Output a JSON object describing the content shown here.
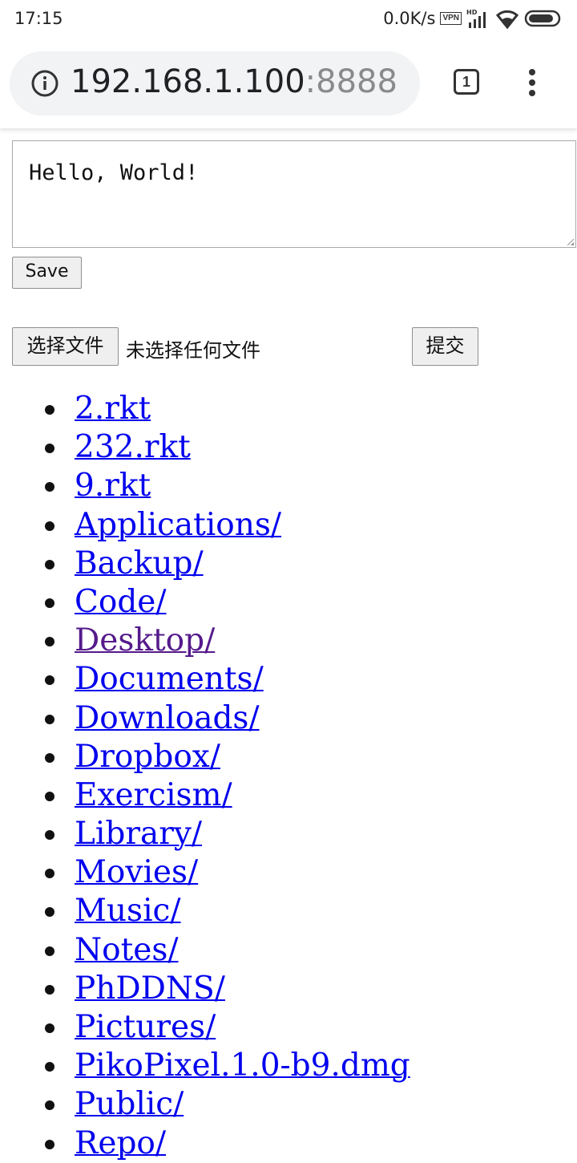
{
  "status_bar": {
    "time": "17:15",
    "net_speed": "0.0K/s",
    "vpn_label": "VPN",
    "hd_label": "HD"
  },
  "browser": {
    "url_host": "192.168.1.100",
    "url_port": ":8888",
    "tab_count": "1"
  },
  "editor": {
    "text": "Hello, World!",
    "save_label": "Save"
  },
  "upload": {
    "choose_label": "选择文件",
    "no_file_text": "未选择任何文件",
    "submit_label": "提交"
  },
  "files": [
    {
      "name": "2.rkt",
      "visited": false
    },
    {
      "name": "232.rkt",
      "visited": false
    },
    {
      "name": "9.rkt",
      "visited": false
    },
    {
      "name": "Applications/",
      "visited": false
    },
    {
      "name": "Backup/",
      "visited": false
    },
    {
      "name": "Code/",
      "visited": false
    },
    {
      "name": "Desktop/",
      "visited": true
    },
    {
      "name": "Documents/",
      "visited": false
    },
    {
      "name": "Downloads/",
      "visited": false
    },
    {
      "name": "Dropbox/",
      "visited": false
    },
    {
      "name": "Exercism/",
      "visited": false
    },
    {
      "name": "Library/",
      "visited": false
    },
    {
      "name": "Movies/",
      "visited": false
    },
    {
      "name": "Music/",
      "visited": false
    },
    {
      "name": "Notes/",
      "visited": false
    },
    {
      "name": "PhDDNS/",
      "visited": false
    },
    {
      "name": "Pictures/",
      "visited": false
    },
    {
      "name": "PikoPixel.1.0-b9.dmg",
      "visited": false
    },
    {
      "name": "Public/",
      "visited": false
    },
    {
      "name": "Repo/",
      "visited": false
    }
  ],
  "colors": {
    "link": "#0000ee",
    "link_visited": "#551a8b"
  }
}
